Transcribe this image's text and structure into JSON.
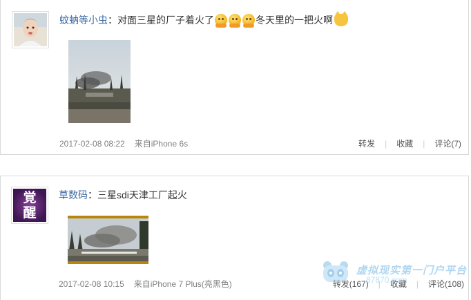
{
  "posts": [
    {
      "username": "蚊蚋等小虫",
      "text_before_emoji": "：对面三星的厂子着火了",
      "text_after_emoji": "冬天里的一把火啊",
      "emojis": [
        "hug-emoji",
        "hug-emoji",
        "hug-emoji"
      ],
      "trailing_emoji": "cat-emoji",
      "timestamp": "2017-02-08 08:22",
      "source": "来自iPhone 6s",
      "actions": {
        "repost": "转发",
        "favorite": "收藏",
        "comment": "评论(7)"
      }
    },
    {
      "username": "草数码",
      "text": "：三星sdi天津工厂起火",
      "avatar_text": [
        "覚",
        "醒"
      ],
      "timestamp": "2017-02-08 10:15",
      "source": "来自iPhone 7 Plus(亮黑色)",
      "actions": {
        "repost": "转发(167)",
        "favorite": "收藏",
        "comment": "评论(108)"
      }
    }
  ],
  "watermark": {
    "text": "虚拟现实第一门户平台",
    "url": "87870.com"
  },
  "colors": {
    "username": "#3b6aa6",
    "meta": "#808080",
    "border": "#d9d9d9",
    "avatar2_bg": "#5a2a6e"
  }
}
